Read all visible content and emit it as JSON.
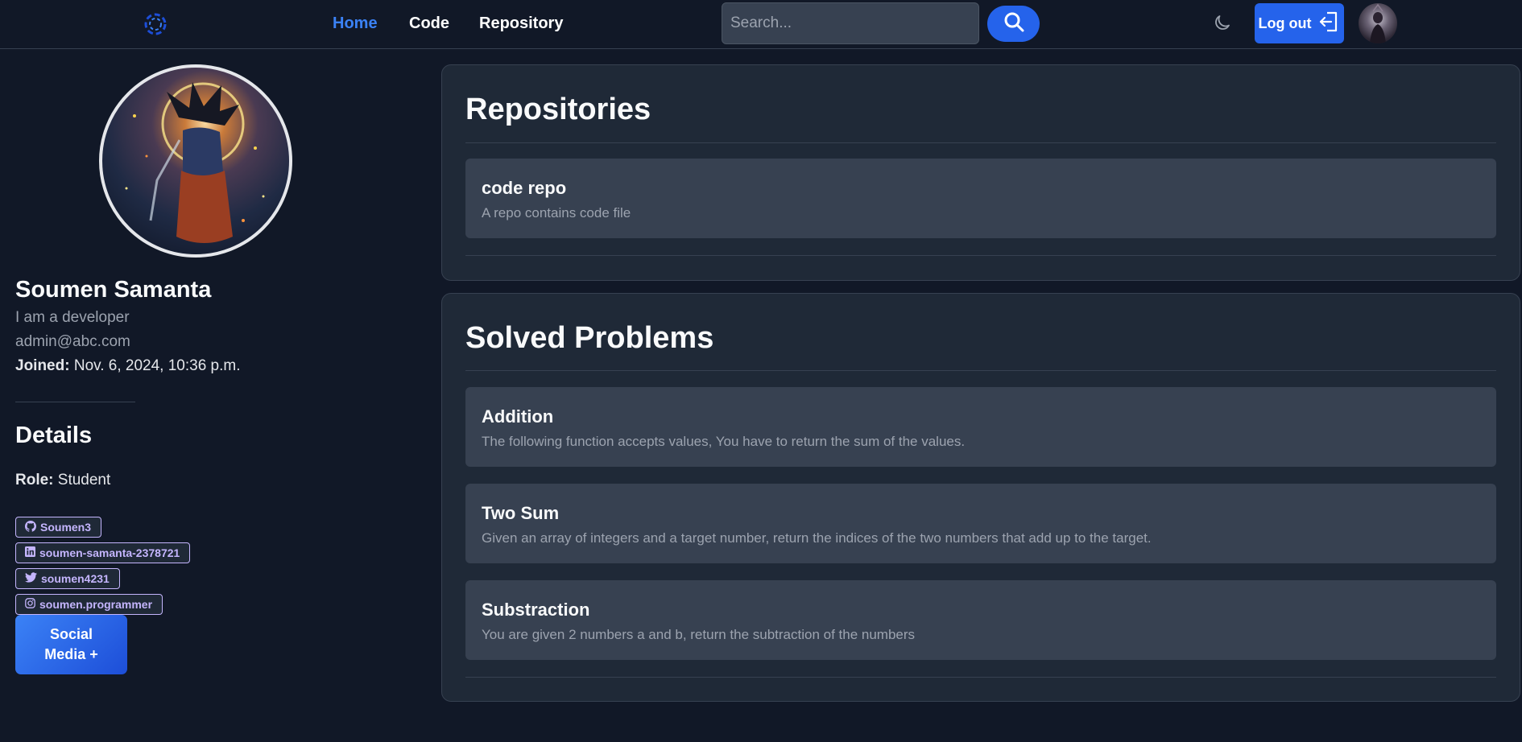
{
  "nav": {
    "links": [
      {
        "label": "Home",
        "active": true
      },
      {
        "label": "Code",
        "active": false
      },
      {
        "label": "Repository",
        "active": false
      }
    ],
    "search_placeholder": "Search...",
    "logout_label": "Log out"
  },
  "profile": {
    "name": "Soumen Samanta",
    "bio": "I am a developer",
    "email": "admin@abc.com",
    "joined_label": "Joined:",
    "joined_value": "Nov. 6, 2024, 10:36 p.m.",
    "details_title": "Details",
    "role_label": "Role:",
    "role_value": "Student",
    "socials": [
      {
        "icon": "github-icon",
        "label": "Soumen3"
      },
      {
        "icon": "linkedin-icon",
        "label": "soumen-samanta-2378721"
      },
      {
        "icon": "twitter-icon",
        "label": "soumen4231"
      },
      {
        "icon": "instagram-icon",
        "label": "soumen.programmer"
      }
    ],
    "social_button_label": "Social Media +"
  },
  "repositories": {
    "title": "Repositories",
    "items": [
      {
        "name": "code repo",
        "description": "A repo contains code file"
      }
    ]
  },
  "solved": {
    "title": "Solved Problems",
    "items": [
      {
        "name": "Addition",
        "description": "The following function accepts values, You have to return the sum of the values."
      },
      {
        "name": "Two Sum",
        "description": "Given an array of integers and a target number, return the indices of the two numbers that add up to the target."
      },
      {
        "name": "Substraction",
        "description": "You are given 2 numbers a and b, return the subtraction of the numbers"
      }
    ]
  },
  "colors": {
    "background": "#111827",
    "card": "#1f2937",
    "item": "#374151",
    "accent": "#2563eb",
    "link_active": "#3b82f6",
    "chip": "#c4b5fd"
  }
}
